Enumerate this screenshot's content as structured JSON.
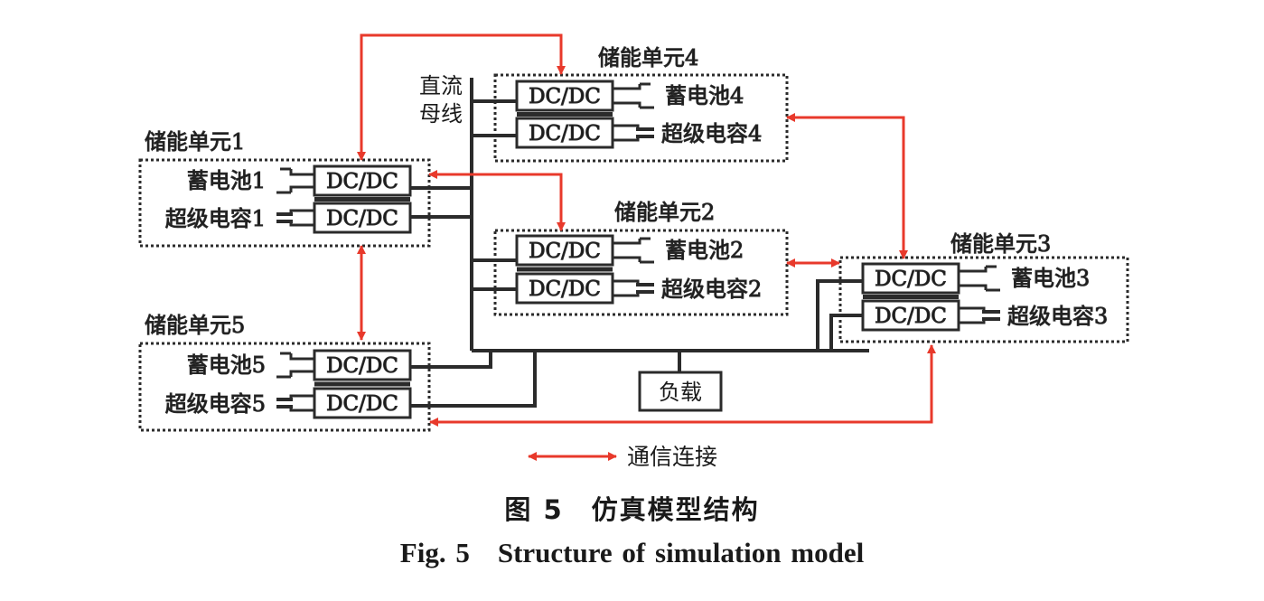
{
  "bus_label_line1": "直流",
  "bus_label_line2": "母线",
  "converter_label": "DC/DC",
  "load_label": "负载",
  "legend_label": "通信连接",
  "units": [
    {
      "title": "储能单元1",
      "battery": "蓄电池1",
      "supercap": "超级电容1"
    },
    {
      "title": "储能单元2",
      "battery": "蓄电池2",
      "supercap": "超级电容2"
    },
    {
      "title": "储能单元3",
      "battery": "蓄电池3",
      "supercap": "超级电容3"
    },
    {
      "title": "储能单元4",
      "battery": "蓄电池4",
      "supercap": "超级电容4"
    },
    {
      "title": "储能单元5",
      "battery": "蓄电池5",
      "supercap": "超级电容5"
    }
  ],
  "caption_cn": "图 5　仿真模型结构",
  "caption_en": "Fig. 5　Structure of simulation model",
  "colors": {
    "line": "#2b2b2b",
    "comm": "#e8392b"
  }
}
